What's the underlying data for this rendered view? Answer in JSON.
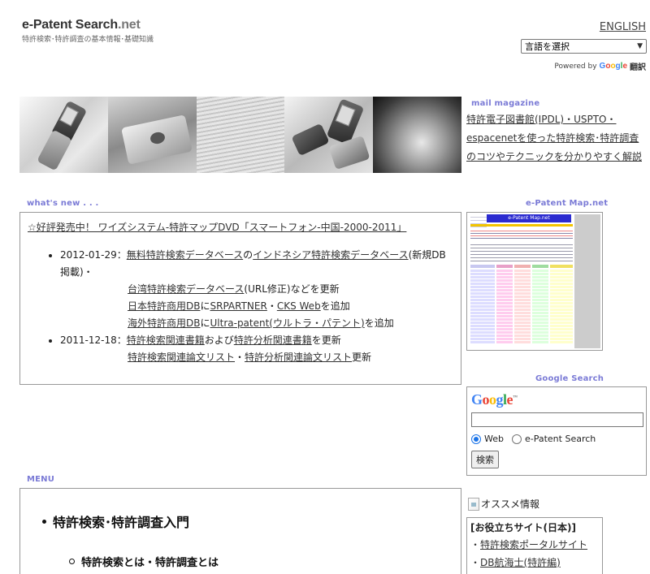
{
  "header": {
    "logo_main": "e-Patent Search",
    "logo_net": ".net",
    "tagline": "特許検索･特許調査の基本情報･基礎知識",
    "english_link": "ENGLISH",
    "language_select": "言語を選択",
    "powered_by": "Powered by",
    "google": "Google",
    "translate": "翻訳"
  },
  "sections": {
    "mail_magazine": "mail magazine",
    "whats_new": "what's new . . .",
    "map_net": "e-Patent Map.net",
    "google_search": "Google Search",
    "menu": "MENU"
  },
  "mail_magazine": {
    "text": "特許電子図書館(IPDL)・USPTO・espacenetを使った特許検索･特許調査のコツやテクニックを分かりやすく解説"
  },
  "news": {
    "headline": "☆好評発売中！ ワイズシステム-特許マップDVD「スマートフォン-中国-2000-2011」",
    "items": [
      {
        "date": "2012-01-29：",
        "line1_a": "無料特許検索データベース",
        "line1_b": "の",
        "line1_c": "インドネシア特許検索データベース",
        "line1_d": "(新規DB掲載)・",
        "line2_a": "台湾特許検索データベース",
        "line2_b": "(URL修正)などを更新",
        "line3_a": "日本特許商用DB",
        "line3_b": "に",
        "line3_c": "SRPARTNER",
        "line3_d": "・",
        "line3_e": "CKS Web",
        "line3_f": "を追加",
        "line4_a": "海外特許商用DB",
        "line4_b": "に",
        "line4_c": "Ultra-patent(ウルトラ・パテント)",
        "line4_d": "を追加"
      },
      {
        "date": "2011-12-18：",
        "line1_a": "特許検索関連書籍",
        "line1_b": "および",
        "line1_c": "特許分析関連書籍",
        "line1_d": "を更新",
        "line2_a": "特許検索関連論文リスト",
        "line2_b": "・",
        "line2_c": "特許分析関連論文リスト",
        "line2_d": "更新"
      }
    ]
  },
  "map_thumbnail_title": "e-Patent Map.net",
  "gsearch": {
    "logo": "Google",
    "radio_web": "Web",
    "radio_site": "e-Patent Search",
    "button": "検索"
  },
  "menu": {
    "item1": "特許検索･特許調査入門",
    "item1_sub": "特許検索とは・特許調査とは"
  },
  "sidebar": {
    "osusume_alt": "オススメ情報",
    "useful_header": "[お役立ちサイト(日本)]",
    "useful_items": [
      "特許検索ポータルサイト",
      "DB航海士(特許編)"
    ],
    "bullet": "・"
  },
  "colors": {
    "section_label": "#7b7bd6",
    "google_blue": "#4285f4",
    "google_red": "#ea4335",
    "google_yellow": "#fbbc05",
    "google_green": "#34a853"
  }
}
